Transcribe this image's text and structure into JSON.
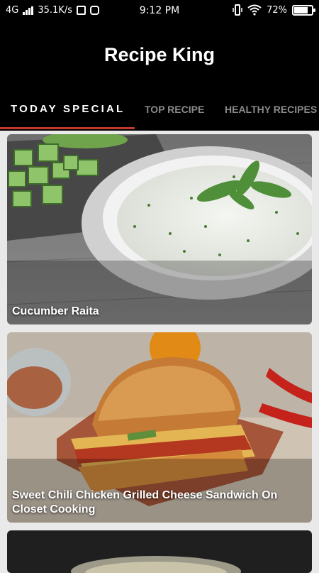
{
  "status_bar": {
    "network": "4G",
    "speed": "35.1K/s",
    "time": "9:12 PM",
    "battery_percent": "72%",
    "battery_level": 0.72
  },
  "app": {
    "title": "Recipe King"
  },
  "tabs": [
    {
      "label": "TODAY SPECIAL",
      "active": true
    },
    {
      "label": "TOP RECIPE",
      "active": false
    },
    {
      "label": "HEALTHY RECIPES",
      "active": false
    }
  ],
  "recipes": [
    {
      "title": "Cucumber Raita"
    },
    {
      "title": "Sweet Chili Chicken Grilled Cheese Sandwich On Closet Cooking"
    }
  ],
  "colors": {
    "app_bar": "#000000",
    "tab_indicator": "#c0392b",
    "inactive_tab": "#8a8a8a"
  }
}
